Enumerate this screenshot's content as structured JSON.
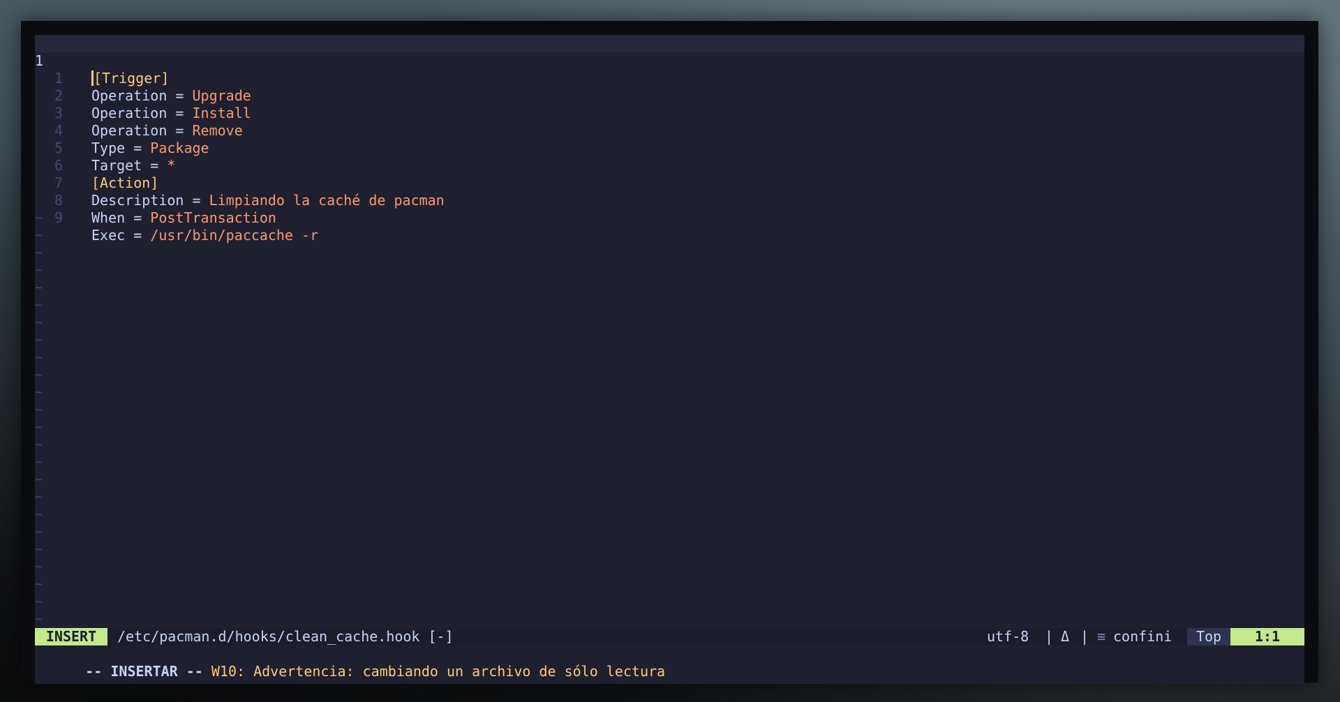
{
  "editor": {
    "current_line_number": "1",
    "lines": [
      {
        "num": "1",
        "section": "[Trigger]"
      },
      {
        "num": "1",
        "key": "Operation",
        "eq": " = ",
        "value": "Upgrade"
      },
      {
        "num": "2",
        "key": "Operation",
        "eq": " = ",
        "value": "Install"
      },
      {
        "num": "3",
        "key": "Operation",
        "eq": " = ",
        "value": "Remove"
      },
      {
        "num": "4",
        "key": "Type",
        "eq": " = ",
        "value": "Package"
      },
      {
        "num": "5",
        "key": "Target",
        "eq": " = ",
        "value": "*"
      },
      {
        "num": "6",
        "section": "[Action]"
      },
      {
        "num": "7",
        "key": "Description",
        "eq": " = ",
        "value": "Limpiando la caché de pacman"
      },
      {
        "num": "8",
        "key": "When",
        "eq": " = ",
        "value": "PostTransaction"
      },
      {
        "num": "9",
        "key": "Exec",
        "eq": " = ",
        "value": "/usr/bin/paccache -r"
      }
    ],
    "empty_marker": "~"
  },
  "statusline": {
    "mode": "INSERT",
    "filepath": "/etc/pacman.d/hooks/clean_cache.hook [-]",
    "encoding": "utf-8",
    "separator": "|",
    "os_icon": "Δ",
    "filetype_icon": "≡",
    "filetype": "confini",
    "scroll": "Top",
    "position": "1:1"
  },
  "message": {
    "mode": "-- INSERTAR --",
    "warning": " W10: Advertencia: cambiando un archivo de sólo lectura"
  },
  "colors": {
    "background": "#1e2030",
    "foreground": "#c8d3f5",
    "value": "#ff966c",
    "section": "#ffc777",
    "mode_badge": "#c3e88d",
    "line_number": "#444a73"
  }
}
